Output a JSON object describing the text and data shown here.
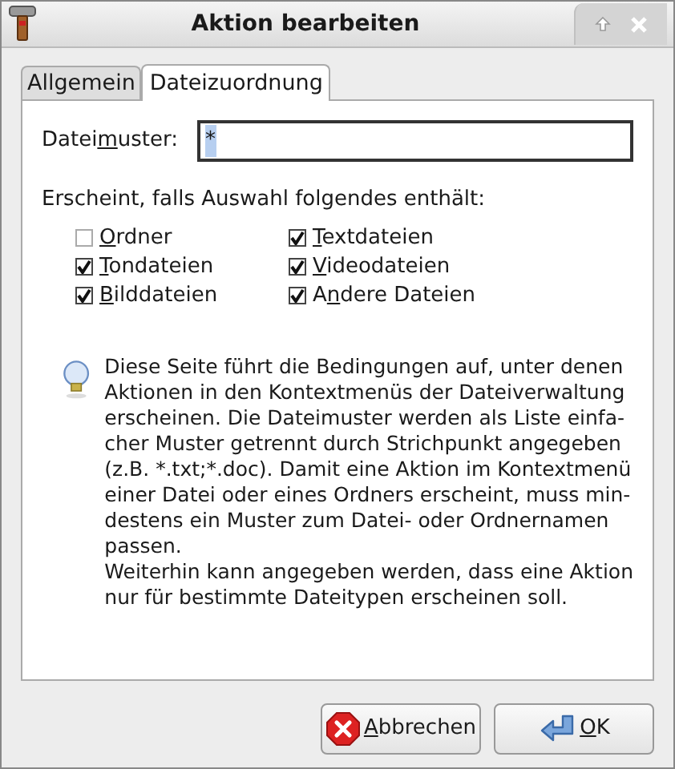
{
  "window": {
    "title": "Aktion bearbeiten"
  },
  "tabs": [
    {
      "label": "Allgemein",
      "selected": false
    },
    {
      "label": "Dateizuordnung",
      "selected": true
    }
  ],
  "pattern": {
    "label": {
      "before": "Datei",
      "key": "m",
      "after": "uster:"
    },
    "value": "*"
  },
  "appears_label": "Erscheint, falls Auswahl folgendes enthält:",
  "checkboxes": [
    {
      "label": {
        "key": "O",
        "after": "rdner"
      },
      "checked": false
    },
    {
      "label": {
        "key": "T",
        "after": "extdateien"
      },
      "checked": true
    },
    {
      "label": {
        "key": "T",
        "after": "ondateien"
      },
      "checked": true
    },
    {
      "label": {
        "key": "V",
        "after": "ideodateien"
      },
      "checked": true
    },
    {
      "label": {
        "key": "B",
        "after": "ilddateien"
      },
      "checked": true
    },
    {
      "label": {
        "before": "A",
        "key": "n",
        "after": "dere Dateien"
      },
      "checked": true
    }
  ],
  "info_lines": [
    "Diese Seite führt die Bedingungen auf, unter denen",
    "Aktionen in den Kontextmenüs der Dateiverwaltung",
    "erscheinen. Die Dateimuster werden als Liste einfa-",
    "cher Muster getrennt durch Strichpunkt angegeben",
    "(z.B. *.txt;*.doc). Damit eine Aktion im Kontextmenü",
    "einer Datei oder eines Ordners erscheint, muss min-",
    "destens ein Muster zum Datei- oder Ordnernamen",
    "passen.",
    "Weiterhin kann angegeben werden, dass eine Aktion",
    "nur für bestimmte Dateitypen erscheinen soll."
  ],
  "buttons": [
    {
      "label": {
        "key": "A",
        "after": "bbrechen"
      },
      "kind": "cancel"
    },
    {
      "label": {
        "key": "O",
        "after": "K"
      },
      "kind": "ok"
    }
  ]
}
